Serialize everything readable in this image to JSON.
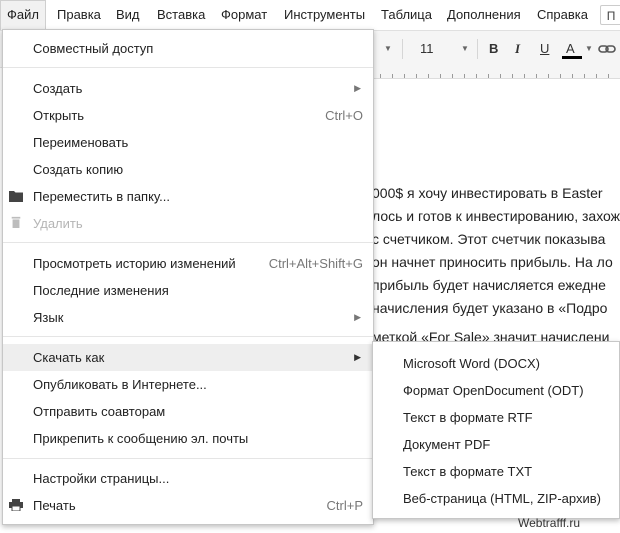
{
  "menubar": {
    "items": [
      "Файл",
      "Правка",
      "Вид",
      "Вставка",
      "Формат",
      "Инструменты",
      "Таблица",
      "Дополнения",
      "Справка"
    ],
    "extra": "П"
  },
  "toolbar": {
    "font_size": "11",
    "bold": "B",
    "italic": "I",
    "underline": "U",
    "text_color": "A"
  },
  "document": {
    "lines": [
      "000$  я хочу инвестировать в Easter",
      "лось и готов к инвестированию, захож",
      " с счетчиком. Этот счетчик показыва",
      "он начнет приносить прибыль. На ло",
      "прибыль будет начисляется ежедне",
      "начисления будет указано в «Подро",
      "меткой «For Sale» значит начислени"
    ]
  },
  "file_menu": {
    "items": [
      {
        "label": "Совместный доступ"
      },
      {
        "label": "Создать",
        "submenu": true
      },
      {
        "label": "Открыть",
        "shortcut": "Ctrl+O"
      },
      {
        "label": "Переименовать"
      },
      {
        "label": "Создать копию"
      },
      {
        "label": "Переместить в папку...",
        "icon": "folder-icon"
      },
      {
        "label": "Удалить",
        "icon": "trash-icon",
        "disabled": true
      },
      {
        "label": "Просмотреть историю изменений",
        "shortcut": "Ctrl+Alt+Shift+G"
      },
      {
        "label": "Последние изменения"
      },
      {
        "label": "Язык",
        "submenu": true
      },
      {
        "label": "Скачать как",
        "submenu": true,
        "hover": true
      },
      {
        "label": "Опубликовать в Интернете..."
      },
      {
        "label": "Отправить соавторам"
      },
      {
        "label": "Прикрепить к сообщению эл. почты"
      },
      {
        "label": "Настройки страницы..."
      },
      {
        "label": "Печать",
        "shortcut": "Ctrl+P",
        "icon": "printer-icon"
      }
    ]
  },
  "download_submenu": {
    "items": [
      "Microsoft Word (DOCX)",
      "Формат OpenDocument (ODT)",
      "Текст в формате RTF",
      "Документ PDF",
      "Текст в формате TXT",
      "Веб-страница (HTML, ZIP-архив)"
    ]
  },
  "watermark": "Webtrafff.ru",
  "colors": {
    "hover_bg": "#eeeeee",
    "disabled_text": "#b5b5b5",
    "text_color_bar": "#000000",
    "accent_red": "#dd3333"
  }
}
